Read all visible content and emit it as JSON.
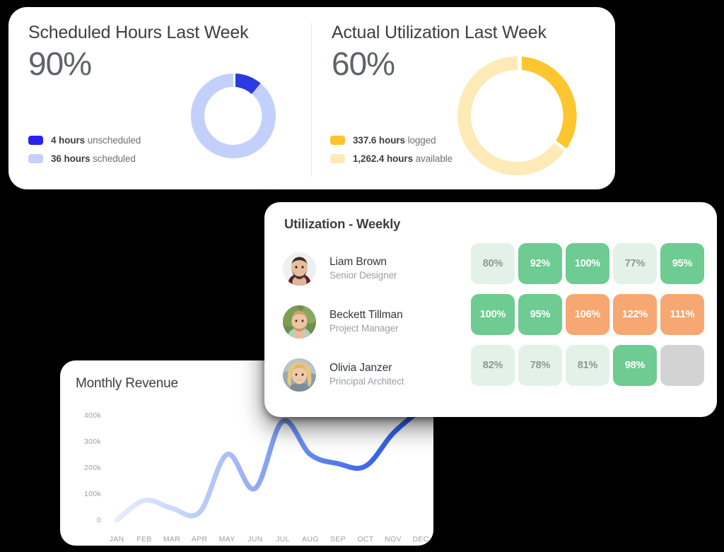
{
  "kpi_cards": [
    {
      "title": "Scheduled Hours Last Week",
      "value": "90%",
      "donut": {
        "accent_color": "#2a3ae0",
        "base_color": "#c2d0fb",
        "accent_pct": 10,
        "base_pct": 90
      },
      "legend": [
        {
          "swatch": "#2a21f0",
          "value": "4 hours",
          "label": " unscheduled"
        },
        {
          "swatch": "#c2d0fb",
          "value": "36 hours",
          "label": " scheduled"
        }
      ]
    },
    {
      "title": "Actual Utilization Last Week",
      "value": "60%",
      "donut": {
        "accent_color": "#fdc62e",
        "base_color": "#fdeab6",
        "accent_pct": 38,
        "base_pct": 62
      },
      "legend": [
        {
          "swatch": "#fdc330",
          "value": "337.6 hours",
          "label": " logged"
        },
        {
          "swatch": "#fdeab6",
          "value": "1,262.4 hours",
          "label": " available"
        }
      ]
    }
  ],
  "utilization": {
    "title": "Utilization - Weekly",
    "people": [
      {
        "name": "Liam Brown",
        "role": "Senior Designer",
        "avatar": "avatar-liam"
      },
      {
        "name": "Beckett Tillman",
        "role": "Project Manager",
        "avatar": "avatar-beckett"
      },
      {
        "name": "Olivia Janzer",
        "role": "Principal Architect",
        "avatar": "avatar-olivia"
      }
    ],
    "cells": [
      [
        {
          "text": "80%",
          "bg": "#e2f2e9",
          "fg": "#8b9a93"
        },
        {
          "text": "92%",
          "bg": "#6ecb91",
          "fg": "#ffffff"
        },
        {
          "text": "100%",
          "bg": "#6ecb91",
          "fg": "#ffffff"
        },
        {
          "text": "77%",
          "bg": "#e2f2e9",
          "fg": "#8b9a93"
        },
        {
          "text": "95%",
          "bg": "#6ecb91",
          "fg": "#ffffff"
        }
      ],
      [
        {
          "text": "100%",
          "bg": "#6ecb91",
          "fg": "#ffffff"
        },
        {
          "text": "95%",
          "bg": "#6ecb91",
          "fg": "#ffffff"
        },
        {
          "text": "106%",
          "bg": "#f7a772",
          "fg": "#ffffff"
        },
        {
          "text": "122%",
          "bg": "#f7a772",
          "fg": "#ffffff"
        },
        {
          "text": "111%",
          "bg": "#f7a772",
          "fg": "#ffffff"
        }
      ],
      [
        {
          "text": "82%",
          "bg": "#e2f2e9",
          "fg": "#8b9a93"
        },
        {
          "text": "78%",
          "bg": "#e2f2e9",
          "fg": "#8b9a93"
        },
        {
          "text": "81%",
          "bg": "#e2f2e9",
          "fg": "#8b9a93"
        },
        {
          "text": "98%",
          "bg": "#6ecb91",
          "fg": "#ffffff"
        },
        {
          "text": "",
          "bg": "#d3d3d3",
          "fg": "#d3d3d3"
        }
      ]
    ]
  },
  "revenue": {
    "title": "Monthly Revenue"
  },
  "chart_data": {
    "type": "line",
    "title": "Monthly Revenue",
    "xlabel": "",
    "ylabel": "",
    "grid": false,
    "legend": "none",
    "ylim": [
      0,
      450000
    ],
    "yticks": [
      0,
      100000,
      200000,
      300000,
      400000
    ],
    "ytick_labels": [
      "0",
      "100k",
      "200k",
      "300k",
      "400k"
    ],
    "categories": [
      "JAN",
      "FEB",
      "MAR",
      "APR",
      "MAY",
      "JUN",
      "JUL",
      "AUG",
      "SEP",
      "OCT",
      "NOV",
      "DEC"
    ],
    "series": [
      {
        "name": "Revenue",
        "gradient_from": "#e3eafd",
        "gradient_to": "#2f5be8",
        "values": [
          0,
          75000,
          45000,
          30000,
          250000,
          120000,
          375000,
          250000,
          215000,
          205000,
          330000,
          420000
        ]
      }
    ]
  }
}
